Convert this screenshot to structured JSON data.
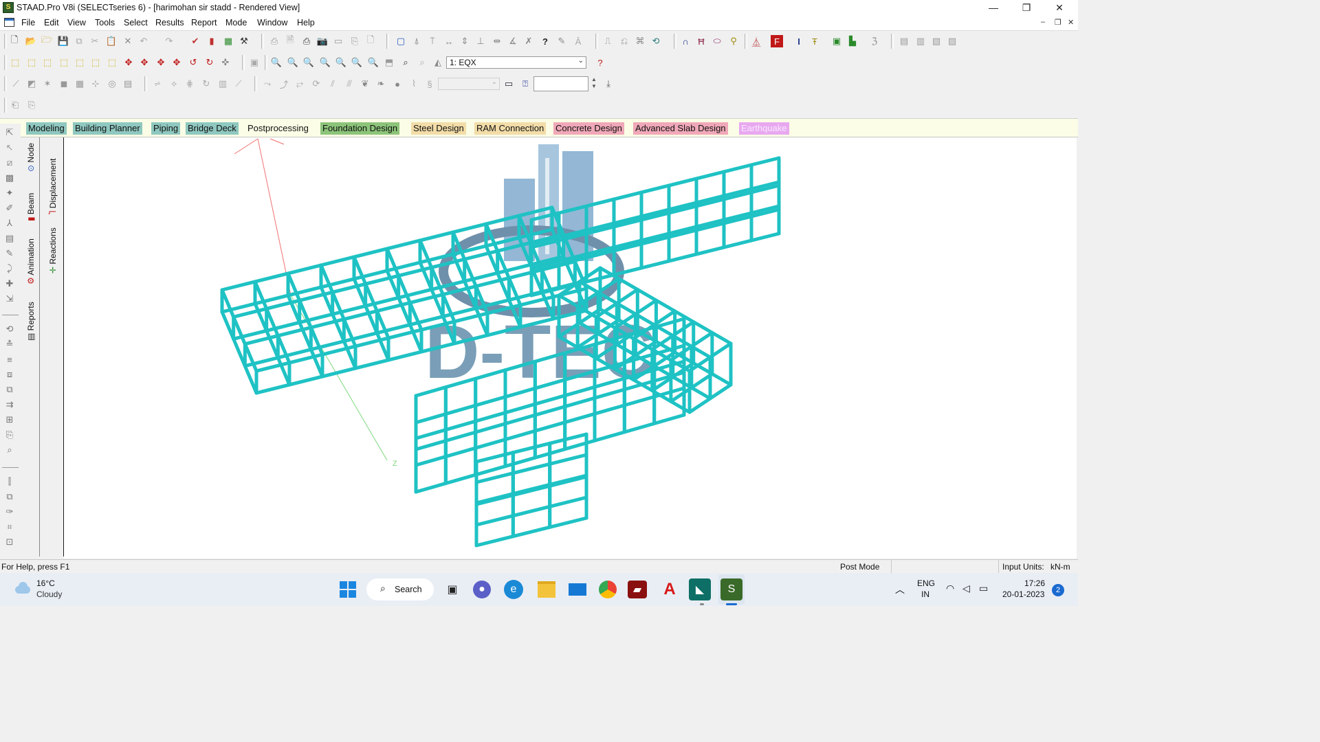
{
  "window": {
    "title": "STAAD.Pro V8i (SELECTseries 6) - [harimohan sir stadd - Rendered View]",
    "minimize": "—",
    "restore": "❐",
    "close": "✕"
  },
  "menu": {
    "items": [
      "File",
      "Edit",
      "View",
      "Tools",
      "Select",
      "Results",
      "Report",
      "Mode",
      "Window",
      "Help"
    ],
    "mdi_min": "–",
    "mdi_restore": "❐",
    "mdi_close": "✕"
  },
  "toolbar": {
    "load_case_select": "1: EQX",
    "help_button": "?",
    "input_box": ""
  },
  "tabs": [
    {
      "label": "Modeling",
      "color": "#8fc8c0"
    },
    {
      "label": "Building Planner",
      "color": "#8fc8c0"
    },
    {
      "label": "Piping",
      "color": "#8fc8c0"
    },
    {
      "label": "Bridge Deck",
      "color": "#8fc8c0"
    },
    {
      "label": "Postprocessing",
      "color": "#fbfde6"
    },
    {
      "label": "Foundation Design",
      "color": "#8cc47a"
    },
    {
      "label": "Steel Design",
      "color": "#f2dca8"
    },
    {
      "label": "RAM Connection",
      "color": "#f2dca8"
    },
    {
      "label": "Concrete Design",
      "color": "#f0a8b8"
    },
    {
      "label": "Advanced Slab Design",
      "color": "#f0a8b8"
    },
    {
      "label": "Earthquake",
      "color": "#e8a8f0"
    }
  ],
  "side_tabs": {
    "left": [
      "Node",
      "Beam",
      "Animation",
      "Reports"
    ],
    "right": [
      "Displacement",
      "Reactions"
    ]
  },
  "viewport": {
    "watermark_text": "D-TEC",
    "axis_label_z": "Z",
    "structure_color": "#1fc2c4"
  },
  "status": {
    "help": "For Help, press F1",
    "mode": "Post Mode",
    "units_label": "Input Units:",
    "units_value": "kN-m"
  },
  "taskbar": {
    "weather_temp": "16°C",
    "weather_desc": "Cloudy",
    "search": "Search",
    "lang_top": "ENG",
    "lang_bottom": "IN",
    "time": "17:26",
    "date": "20-01-2023",
    "notif_count": "2"
  }
}
